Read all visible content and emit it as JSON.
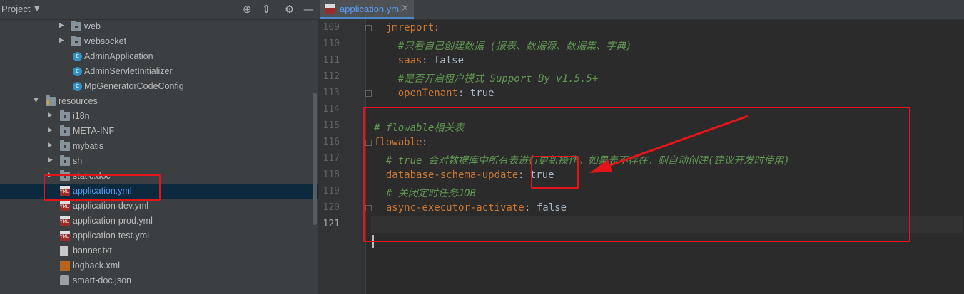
{
  "project_panel": {
    "title": "Project",
    "tree": [
      {
        "label": "web",
        "type": "folder"
      },
      {
        "label": "websocket",
        "type": "folder"
      },
      {
        "label": "AdminApplication",
        "type": "class"
      },
      {
        "label": "AdminServletInitializer",
        "type": "class"
      },
      {
        "label": "MpGeneratorCodeConfig",
        "type": "class"
      },
      {
        "label": "resources",
        "type": "resources"
      },
      {
        "label": "i18n",
        "type": "folder"
      },
      {
        "label": "META-INF",
        "type": "folder"
      },
      {
        "label": "mybatis",
        "type": "folder"
      },
      {
        "label": "sh",
        "type": "folder"
      },
      {
        "label": "static.doc",
        "type": "folder"
      },
      {
        "label": "application.yml",
        "type": "yml",
        "selected": true
      },
      {
        "label": "application-dev.yml",
        "type": "yml"
      },
      {
        "label": "application-prod.yml",
        "type": "yml"
      },
      {
        "label": "application-test.yml",
        "type": "yml"
      },
      {
        "label": "banner.txt",
        "type": "txt"
      },
      {
        "label": "logback.xml",
        "type": "xml"
      },
      {
        "label": "smart-doc.json",
        "type": "json"
      }
    ]
  },
  "editor": {
    "tab_label": "application.yml",
    "lines": [
      {
        "num": "109",
        "parts": [
          {
            "cls": "k",
            "text": "  jmreport"
          },
          {
            "cls": "v",
            "text": ":"
          }
        ]
      },
      {
        "num": "110",
        "parts": [
          {
            "cls": "c",
            "text": "    #只看自己创建数据 (报表、数据源、数据集、字典)"
          }
        ]
      },
      {
        "num": "111",
        "parts": [
          {
            "cls": "k",
            "text": "    saas"
          },
          {
            "cls": "v",
            "text": ": false"
          }
        ]
      },
      {
        "num": "112",
        "parts": [
          {
            "cls": "c",
            "text": "    #是否开启租户模式 Support By v1.5.5+"
          }
        ]
      },
      {
        "num": "113",
        "parts": [
          {
            "cls": "k",
            "text": "    openTenant"
          },
          {
            "cls": "v",
            "text": ": true"
          }
        ]
      },
      {
        "num": "114",
        "parts": []
      },
      {
        "num": "115",
        "parts": [
          {
            "cls": "c",
            "text": "# flowable相关表"
          }
        ]
      },
      {
        "num": "116",
        "parts": [
          {
            "cls": "k",
            "text": "flowable"
          },
          {
            "cls": "v",
            "text": ":"
          }
        ]
      },
      {
        "num": "117",
        "parts": [
          {
            "cls": "c",
            "text": "  # true 会对数据库中所有表进行更新操作。如果表不存在，则自动创建(建议开发时使用)"
          }
        ]
      },
      {
        "num": "118",
        "parts": [
          {
            "cls": "k",
            "text": "  database-schema-update"
          },
          {
            "cls": "v",
            "text": ": true"
          }
        ]
      },
      {
        "num": "119",
        "parts": [
          {
            "cls": "c",
            "text": "  # 关闭定时任务JOB"
          }
        ]
      },
      {
        "num": "120",
        "parts": [
          {
            "cls": "k",
            "text": "  async-executor-activate"
          },
          {
            "cls": "v",
            "text": ": false"
          }
        ]
      },
      {
        "num": "121",
        "parts": [],
        "current": true
      }
    ]
  },
  "colors": {
    "annotation_red": "#e3151a",
    "yaml_key": "#cc7832",
    "yaml_comment": "#629755",
    "selection_text": "#589df6"
  }
}
